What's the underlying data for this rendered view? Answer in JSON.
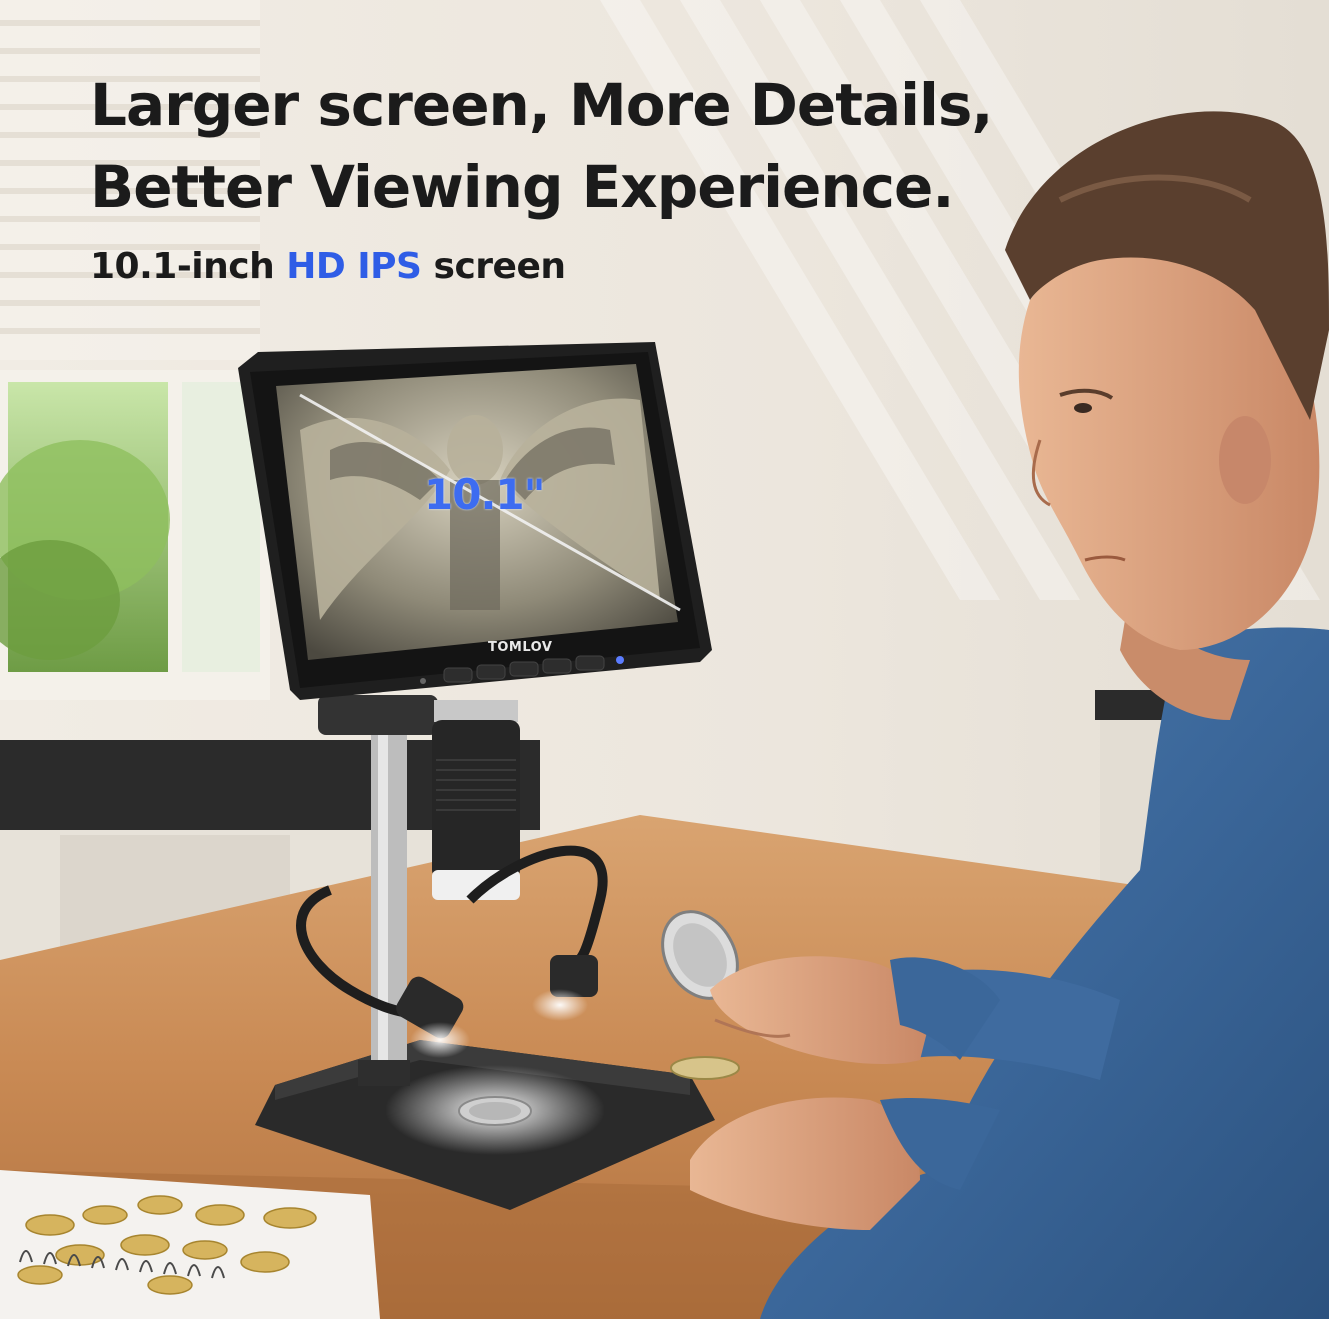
{
  "headline": {
    "line1": "Larger screen, More Details,",
    "line2": "Better Viewing Experience."
  },
  "subheadline": {
    "prefix": "10.1-inch ",
    "highlight": "HD IPS",
    "suffix": " screen"
  },
  "screen_size_label": "10.1\"",
  "brand_logo": "TOMLOV",
  "colors": {
    "headline_text": "#1b1b1b",
    "highlight_blue": "#2f5de6",
    "screen_label_blue": "#3d6cf0"
  }
}
